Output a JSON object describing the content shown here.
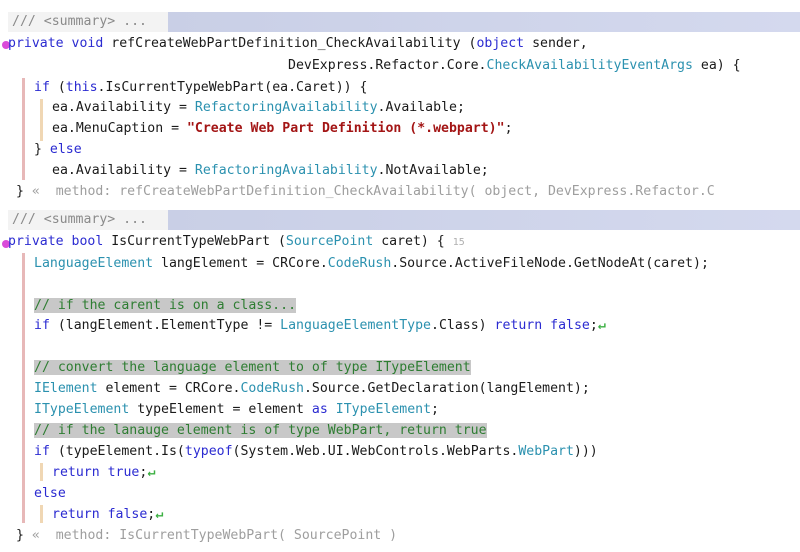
{
  "summary_label": "/// <summary> ...",
  "method1": {
    "line1": {
      "kw1": "private",
      "kw2": "void",
      "name": "refCreateWebPartDefinition_CheckAvailability",
      "p1": " (",
      "kw3": "object",
      "rest": " sender,"
    },
    "line2": {
      "prefix": "DevExpress.Refactor.Core.",
      "type": "CheckAvailabilityEventArgs",
      "rest": " ea) {"
    },
    "line3": {
      "kw1": "if",
      "a": " (",
      "kw2": "this",
      "b": ".IsCurrentTypeWebPart(ea.Caret)) {"
    },
    "line4": {
      "a": "ea.Availability = ",
      "type": "RefactoringAvailability",
      "b": ".Available;"
    },
    "line5": {
      "a": "ea.MenuCaption = ",
      "str": "\"Create Web Part Definition (*.webpart)\"",
      "b": ";"
    },
    "line6": {
      "a": "} ",
      "kw": "else"
    },
    "line7": {
      "a": "ea.Availability = ",
      "type": "RefactoringAvailability",
      "b": ".NotAvailable;"
    },
    "line8": {
      "brace": "}",
      "hint": "«  method: refCreateWebPartDefinition_CheckAvailability( object, DevExpress.Refactor.C"
    }
  },
  "method2": {
    "line1": {
      "kw1": "private",
      "kw2": "bool",
      "name": " IsCurrentTypeWebPart (",
      "type": "SourcePoint",
      "rest": " caret) {",
      "badge": "15"
    },
    "line2": {
      "type": "LanguageElement",
      "a": " langElement = CRCore.",
      "type2": "CodeRush",
      "b": ".Source.ActiveFileNode.GetNodeAt(caret);"
    },
    "line3": {
      "cm": "// if the carent is on a class..."
    },
    "line4": {
      "kw1": "if",
      "a": " (langElement.ElementType != ",
      "type": "LanguageElementType",
      "b": ".Class) ",
      "kw2": "return",
      "c": " ",
      "kw3": "false",
      "d": ";"
    },
    "line5": {
      "cm": "// convert the language element to of type ITypeElement"
    },
    "line6": {
      "type": "IElement",
      "a": " element = CRCore.",
      "type2": "CodeRush",
      "b": ".Source.GetDeclaration(langElement);"
    },
    "line7": {
      "type": "ITypeElement",
      "a": " typeElement = element ",
      "kw": "as",
      "b": " ",
      "type2": "ITypeElement",
      "c": ";"
    },
    "line8": {
      "cm": "// if the lanauge element is of type WebPart, return true"
    },
    "line9": {
      "kw1": "if",
      "a": " (typeElement.Is(",
      "kw2": "typeof",
      "b": "(System.Web.UI.WebControls.WebParts.",
      "type": "WebPart",
      "c": ")))"
    },
    "line10": {
      "kw1": "return",
      "a": " ",
      "kw2": "true",
      "b": ";"
    },
    "line11": {
      "kw": "else"
    },
    "line12": {
      "kw1": "return",
      "a": " ",
      "kw2": "false",
      "b": ";"
    },
    "line13": {
      "brace": "}",
      "hint": "«  method: IsCurrentTypeWebPart( SourcePoint )"
    }
  },
  "return_arrow": "↵"
}
